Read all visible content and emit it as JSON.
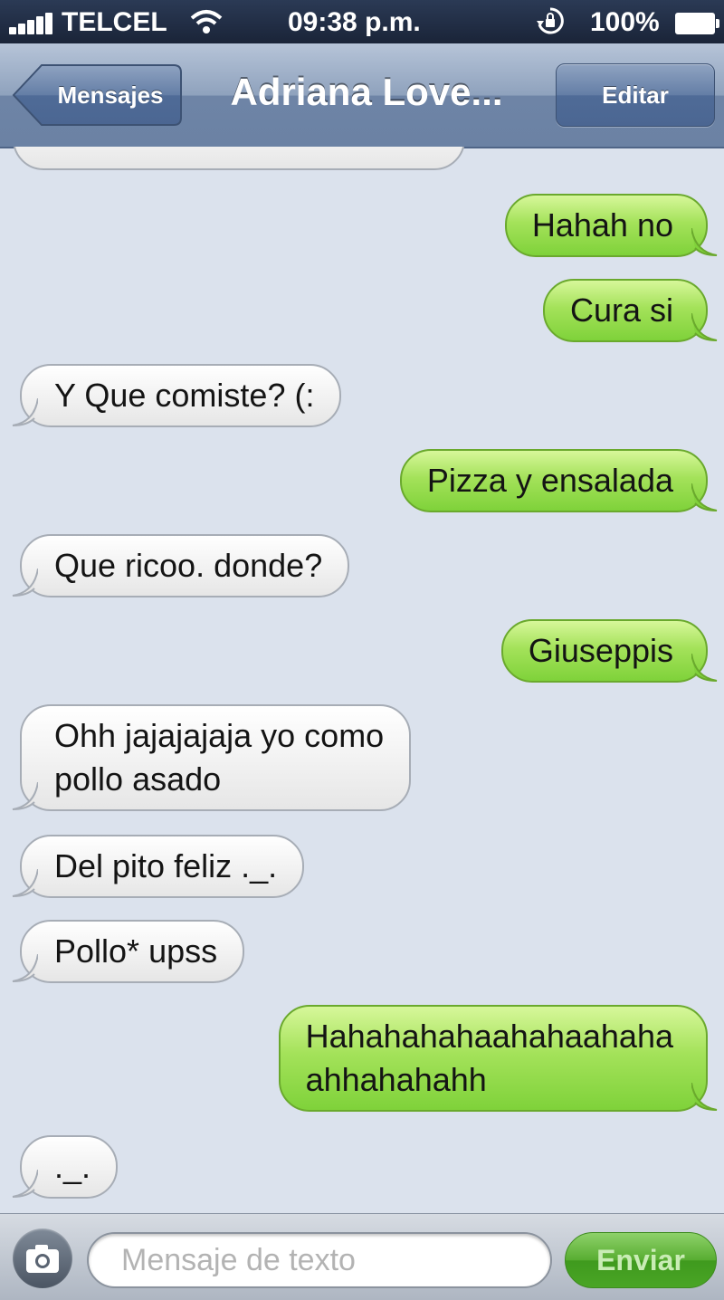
{
  "status_bar": {
    "carrier": "TELCEL",
    "time": "09:38 p.m.",
    "battery": "100%",
    "icons": [
      "signal-icon",
      "wifi-icon",
      "rotation-lock-icon",
      "battery-charging-icon"
    ]
  },
  "nav": {
    "back_label": "Mensajes",
    "title": "Adriana Love...",
    "edit_label": "Editar"
  },
  "messages": [
    {
      "from": "me",
      "text": "Hahah no"
    },
    {
      "from": "me",
      "text": "Cura si"
    },
    {
      "from": "them",
      "text": "Y Que comiste? (:"
    },
    {
      "from": "me",
      "text": "Pizza y ensalada"
    },
    {
      "from": "them",
      "text": "Que ricoo. donde?"
    },
    {
      "from": "me",
      "text": "Giuseppis"
    },
    {
      "from": "them",
      "lines": [
        "Ohh jajajajaja yo como",
        "pollo asado"
      ]
    },
    {
      "from": "them",
      "text": "Del pito feliz ._."
    },
    {
      "from": "them",
      "text": "Pollo* upss"
    },
    {
      "from": "me",
      "lines": [
        "Hahahahahaahahaahaha",
        "ahhahahahh"
      ]
    },
    {
      "from": "them",
      "text": "._."
    }
  ],
  "composer": {
    "placeholder": "Mensaje de texto",
    "send_label": "Enviar"
  },
  "colors": {
    "outgoing_bubble": "#8fd84a",
    "incoming_bubble": "#f2f2f2",
    "background": "#dbe2ed",
    "nav_bar": "#6b82a4"
  }
}
